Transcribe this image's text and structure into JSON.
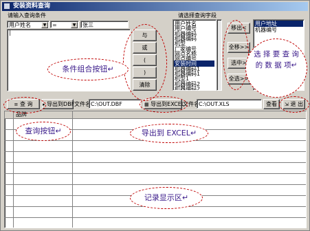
{
  "window": {
    "title": "安装资料查询"
  },
  "conditions": {
    "group_label": "请输入查询条件",
    "field_value": "用户姓名",
    "operator_value": "=",
    "value_text": "张三",
    "editor_text": "|"
  },
  "logic_buttons": {
    "and": "与",
    "or": "或",
    "open_paren": "(",
    "close_paren": ")",
    "clear": "清除"
  },
  "fields_panel": {
    "label": "请选择查询字段",
    "items": [
      "用户姓名",
      "用户编号",
      "机器编码",
      "机器编码",
      "机型",
      "厂家编号",
      "网点名称",
      "网点编号",
      "安装时间",
      "机器编码1",
      "机器编码1",
      "机型1",
      "机器编码2",
      "机器编码2"
    ],
    "selected_index": 8,
    "move_out": "移出<",
    "select_all": "全移>>",
    "select": "选中>",
    "all_select": "全选>>"
  },
  "selected_panel": {
    "items": [
      "用户地址",
      "机器编号"
    ],
    "selected_index": 0
  },
  "toolbar": {
    "query_button": "查 询",
    "export_dbf_button": "导出到DBF",
    "file_label_dbf": "文件名",
    "file_dbf": "C:\\OUT.DBF",
    "export_excel_button": "导出到EXCEL",
    "file_label_xls": "文件名",
    "file_xls": "C:\\OUT.XLS",
    "browse_button": "查看",
    "exit_button": "退 出"
  },
  "grid": {
    "header_col": "品牌"
  },
  "annotations": {
    "combine": "条件组合按钮↵",
    "select_fields": "选 择 要 查 询 的 数 据 项↵",
    "query": "查询按钮↵",
    "export": "导出到 EXCEL↵",
    "records": "记录显示区↵"
  },
  "colors": {
    "title_gradient_start": "#0a246a",
    "selection": "#0a246a",
    "annotation_border": "#c00000",
    "annotation_text": "#3a1a8a"
  }
}
